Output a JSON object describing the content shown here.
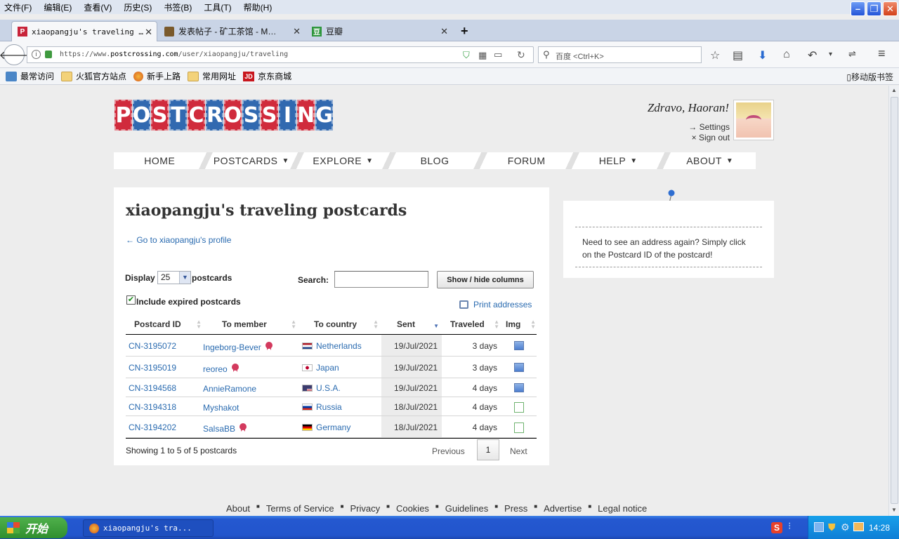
{
  "menu": [
    "文件(F)",
    "编辑(E)",
    "查看(V)",
    "历史(S)",
    "书签(B)",
    "工具(T)",
    "帮助(H)"
  ],
  "tabs": [
    {
      "label": "xiaopangju's traveling …",
      "fav": "P"
    },
    {
      "label": "发表帖子 - 矿工茶馆 - M…",
      "fav": ""
    },
    {
      "label": "豆瓣",
      "fav": "豆"
    }
  ],
  "new_tab": "+",
  "url": {
    "prefix": "https://www.",
    "domain": "postcrossing.com",
    "path": "/user/xiaopangju/traveling"
  },
  "search_placeholder": "百度 <Ctrl+K>",
  "bookmarks": [
    "最常访问",
    "火狐官方站点",
    "新手上路",
    "常用网址",
    "京东商城"
  ],
  "mobile_bookmarks": "移动版书签",
  "site": {
    "logo_letters": [
      "P",
      "O",
      "S",
      "T",
      "C",
      "R",
      "O",
      "S",
      "S",
      "I",
      "N",
      "G"
    ],
    "greeting": "Zdravo, Haoran!",
    "settings": "→ Settings",
    "signout": "× Sign out",
    "nav": [
      {
        "label": "HOME",
        "arrow": ""
      },
      {
        "label": "POSTCARDS",
        "arrow": "▼"
      },
      {
        "label": "EXPLORE",
        "arrow": "▼"
      },
      {
        "label": "BLOG",
        "arrow": ""
      },
      {
        "label": "FORUM",
        "arrow": ""
      },
      {
        "label": "HELP",
        "arrow": "▼"
      },
      {
        "label": "ABOUT",
        "arrow": "▼"
      }
    ]
  },
  "main": {
    "title": "xiaopangju's traveling postcards",
    "profile_link": "← Go to xiaopangju's profile",
    "display_label": "Display",
    "display_value": "25",
    "postcards_label": "postcards",
    "search_label": "Search:",
    "show_hide": "Show / hide columns",
    "include_expired": "Include expired postcards",
    "print_addresses": "Print addresses",
    "columns": [
      "Postcard ID",
      "To member",
      "To country",
      "Sent",
      "Traveled",
      "Img"
    ],
    "rows": [
      {
        "id": "CN-3195072",
        "member": "Ingeborg-Bever",
        "badge": true,
        "country": "Netherlands",
        "flag": "nl",
        "sent": "19/Jul/2021",
        "traveled": "3 days",
        "img": "photo"
      },
      {
        "id": "CN-3195019",
        "member": "reoreo",
        "badge": true,
        "country": "Japan",
        "flag": "jp",
        "sent": "19/Jul/2021",
        "traveled": "3 days",
        "img": "photo"
      },
      {
        "id": "CN-3194568",
        "member": "AnnieRamone",
        "badge": false,
        "country": "U.S.A.",
        "flag": "us",
        "sent": "19/Jul/2021",
        "traveled": "4 days",
        "img": "photo"
      },
      {
        "id": "CN-3194318",
        "member": "Myshakot",
        "badge": false,
        "country": "Russia",
        "flag": "ru",
        "sent": "18/Jul/2021",
        "traveled": "4 days",
        "img": "card"
      },
      {
        "id": "CN-3194202",
        "member": "SalsaBB",
        "badge": true,
        "country": "Germany",
        "flag": "de",
        "sent": "18/Jul/2021",
        "traveled": "4 days",
        "img": "card"
      }
    ],
    "showing": "Showing 1 to 5 of 5 postcards",
    "previous": "Previous",
    "page": "1",
    "next": "Next"
  },
  "tip": "Need to see an address again? Simply click on the Postcard ID of the postcard!",
  "footer": [
    "About",
    "Terms of Service",
    "Privacy",
    "Cookies",
    "Guidelines",
    "Press",
    "Advertise",
    "Legal notice"
  ],
  "footer_sep": "■",
  "taskbar": {
    "start": "开始",
    "item": "xiaopangju's tra...",
    "clock": "14:28"
  },
  "colors": {
    "logo_red": "#d02b3c",
    "logo_blue": "#3169b0",
    "link": "#2a6bb0"
  }
}
